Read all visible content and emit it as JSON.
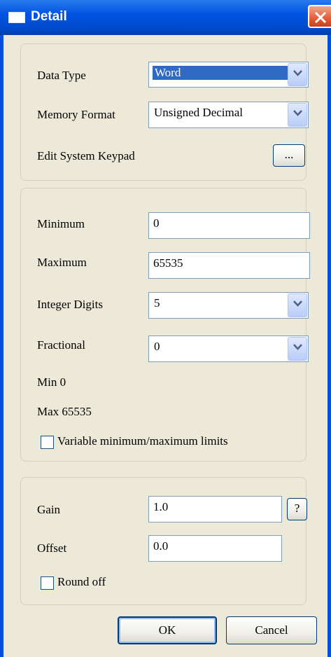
{
  "window": {
    "title": "Detail"
  },
  "display": {
    "data_type": {
      "label": "Data Type",
      "value": "Word"
    },
    "memory_format": {
      "label": "Memory Format",
      "value": "Unsigned Decimal"
    },
    "keypad": {
      "label": "Edit System Keypad",
      "button": "..."
    }
  },
  "range": {
    "minimum": {
      "label": "Minimum",
      "value": "0"
    },
    "maximum": {
      "label": "Maximum",
      "value": "65535"
    },
    "integer_digits": {
      "label": "Integer Digits",
      "value": "5"
    },
    "fractional": {
      "label": "Fractional",
      "value": "0"
    },
    "min_text": "Min 0",
    "max_text": "Max 65535",
    "variable_limits": {
      "label": "Variable minimum/maximum limits",
      "checked": false
    }
  },
  "scaling": {
    "gain": {
      "label": "Gain",
      "value": "1.0",
      "help": "?"
    },
    "offset": {
      "label": "Offset",
      "value": "0.0"
    },
    "round_off": {
      "label": "Round off",
      "checked": false
    }
  },
  "buttons": {
    "ok": "OK",
    "cancel": "Cancel"
  }
}
